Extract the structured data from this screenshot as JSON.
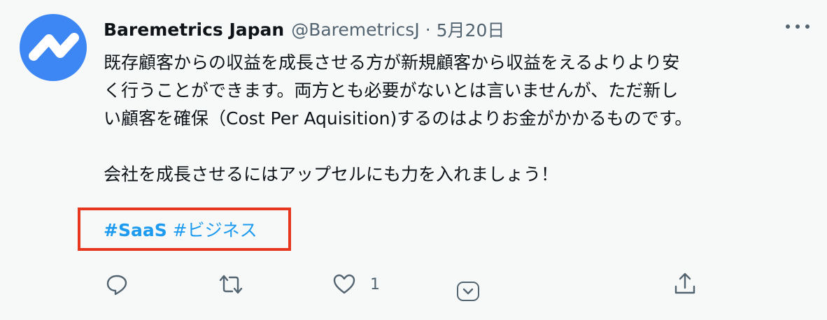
{
  "tweet": {
    "author_name": "Baremetrics Japan",
    "handle": "@BaremetricsJ",
    "separator": "·",
    "date": "5月20日",
    "lines": [
      "既存顧客からの収益を成長させる方が新規顧客から収益をえるよりより安",
      "く行うことができます。両方とも必要がないとは言いませんが、ただ新し",
      "い顧客を確保（Cost Per Aquisition)するのはよりお金がかかるものです。",
      "会社を成長させるにはアップセルにも力を入れましょう！"
    ],
    "hashtags": [
      "#SaaS",
      "#ビジネス"
    ],
    "like_count": "1"
  },
  "icons": {
    "avatar": "baremetrics-logo-icon",
    "more": "more-dots-icon",
    "reply": "reply-icon",
    "retweet": "retweet-icon",
    "like": "heart-icon",
    "extra": "chevron-down-icon",
    "share": "share-icon"
  },
  "colors": {
    "background": "#f7f8f8",
    "avatar": "#3d87f5",
    "text": "#0f1419",
    "muted": "#536471",
    "link": "#1d9bf0",
    "highlight": "#e8371f"
  }
}
